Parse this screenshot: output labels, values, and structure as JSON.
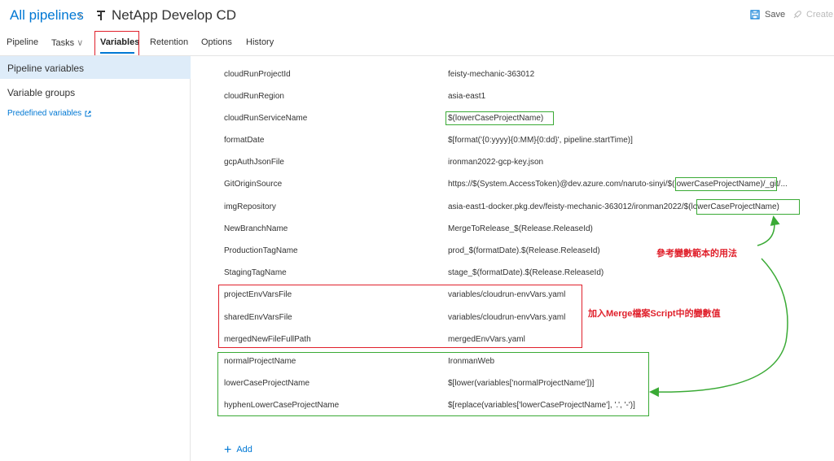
{
  "header": {
    "breadcrumb": "All pipelines",
    "title": "NetApp Develop CD",
    "save_label": "Save",
    "create_label": "Create"
  },
  "tabs": [
    {
      "label": "Pipeline"
    },
    {
      "label": "Tasks"
    },
    {
      "label": "Variables"
    },
    {
      "label": "Retention"
    },
    {
      "label": "Options"
    },
    {
      "label": "History"
    }
  ],
  "sidebar": {
    "items": [
      {
        "label": "Pipeline variables"
      },
      {
        "label": "Variable groups"
      }
    ],
    "predefined_link": "Predefined variables"
  },
  "variables": [
    {
      "name": "cloudRunProjectId",
      "value": "feisty-mechanic-363012"
    },
    {
      "name": "cloudRunRegion",
      "value": "asia-east1"
    },
    {
      "name": "cloudRunServiceName",
      "value": "$(lowerCaseProjectName)"
    },
    {
      "name": "formatDate",
      "value": "$[format('{0:yyyy}{0:MM}{0:dd}', pipeline.startTime)]"
    },
    {
      "name": "gcpAuthJsonFile",
      "value": "ironman2022-gcp-key.json"
    },
    {
      "name": "GitOriginSource",
      "value": "https://$(System.AccessToken)@dev.azure.com/naruto-sinyi/$(lowerCaseProjectName)/_git/..."
    },
    {
      "name": "imgRepository",
      "value": "asia-east1-docker.pkg.dev/feisty-mechanic-363012/ironman2022/$(lowerCaseProjectName)"
    },
    {
      "name": "NewBranchName",
      "value": "MergeToRelease_$(Release.ReleaseId)"
    },
    {
      "name": "ProductionTagName",
      "value": "prod_$(formatDate).$(Release.ReleaseId)"
    },
    {
      "name": "StagingTagName",
      "value": "stage_$(formatDate).$(Release.ReleaseId)"
    },
    {
      "name": "projectEnvVarsFile",
      "value": "variables/cloudrun-envVars.yaml"
    },
    {
      "name": "sharedEnvVarsFile",
      "value": "variables/cloudrun-envVars.yaml"
    },
    {
      "name": "mergedNewFileFullPath",
      "value": "mergedEnvVars.yaml"
    },
    {
      "name": "normalProjectName",
      "value": "IronmanWeb"
    },
    {
      "name": "lowerCaseProjectName",
      "value": "$[lower(variables['normalProjectName'])]"
    },
    {
      "name": "hyphenLowerCaseProjectName",
      "value": "$[replace(variables['lowerCaseProjectName'], '.', '-')]"
    }
  ],
  "add_label": "Add",
  "annotations": {
    "reference_note": "參考變數範本的用法",
    "merge_note": "加入Merge檔案Script中的變數值"
  },
  "colors": {
    "accent": "#0078d4",
    "annotation_red": "#e0202b",
    "annotation_green": "#3aaa35",
    "selected_bg": "#deecf9"
  }
}
